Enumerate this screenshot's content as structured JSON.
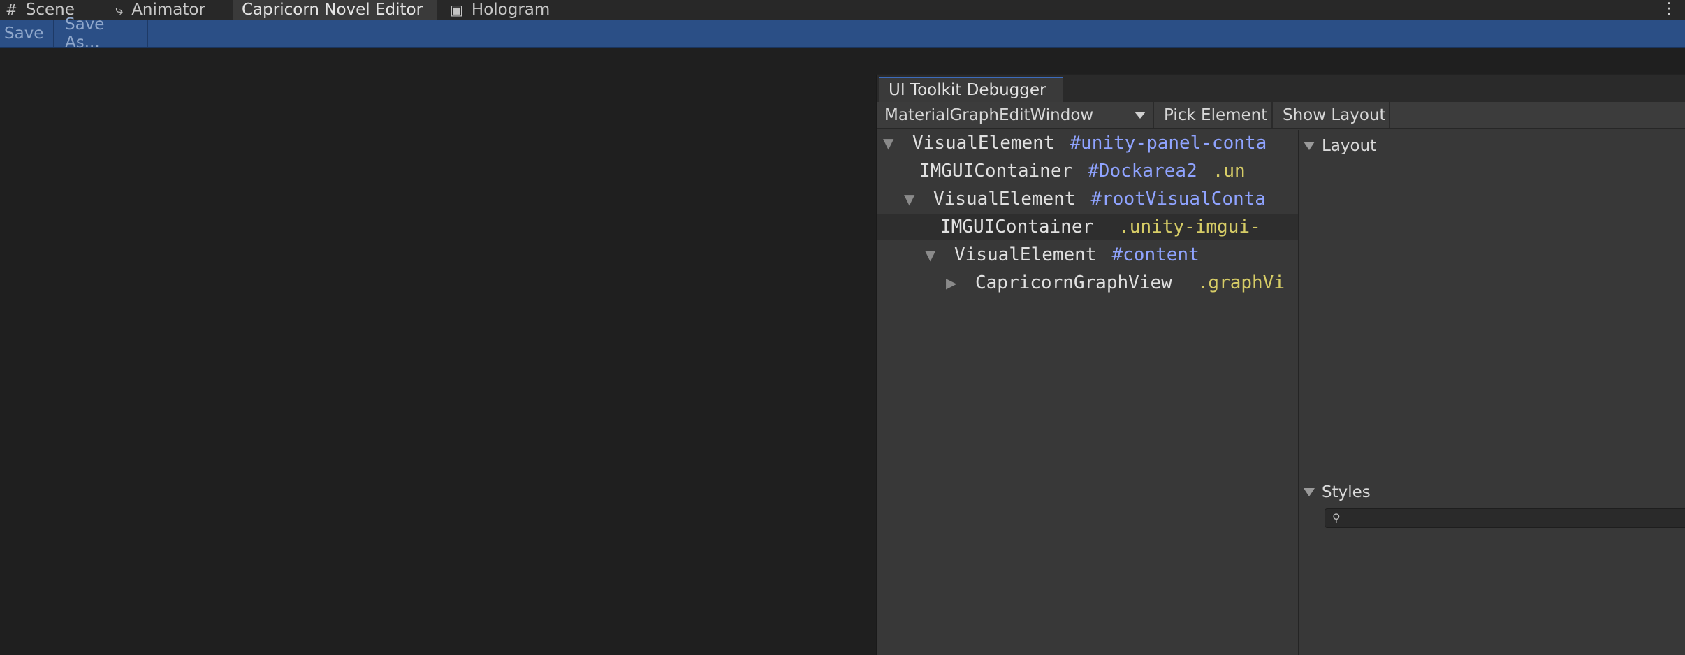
{
  "tabs": [
    {
      "label": "Scene",
      "icon": "grid-icon"
    },
    {
      "label": "Animator",
      "icon": "animator-icon"
    },
    {
      "label": "Capricorn Novel Editor",
      "active": true
    },
    {
      "label": "Hologram",
      "icon": "hologram-icon"
    }
  ],
  "toolbar": {
    "save_label": "Save",
    "save_as_label": "Save As..."
  },
  "debugger": {
    "title": "UI Toolkit Debugger",
    "window_select": "MaterialGraphEditWindow",
    "pick_label": "Pick Element",
    "layout_label": "Show Layout",
    "tree": [
      {
        "type": "VisualElement",
        "id": "#unity-panel-conta",
        "cls": "",
        "expanded": true
      },
      {
        "type": "IMGUIContainer",
        "id": "#Dockarea2",
        "cls": ".un",
        "expanded": null
      },
      {
        "type": "VisualElement",
        "id": "#rootVisualConta",
        "cls": "",
        "expanded": true
      },
      {
        "type": "IMGUIContainer",
        "id": "",
        "cls": ".unity-imgui-",
        "expanded": null,
        "selected": true
      },
      {
        "type": "VisualElement",
        "id": "#content",
        "cls": "",
        "expanded": true
      },
      {
        "type": "CapricornGraphView",
        "id": "",
        "cls": ".graphVi",
        "expanded": false
      }
    ],
    "inspector": {
      "layout_label": "Layout",
      "styles_label": "Styles"
    }
  },
  "colors": {
    "toolbar_bg": "#2b4f86",
    "id_color": "#8fa3ff",
    "class_color": "#d6cc66"
  }
}
